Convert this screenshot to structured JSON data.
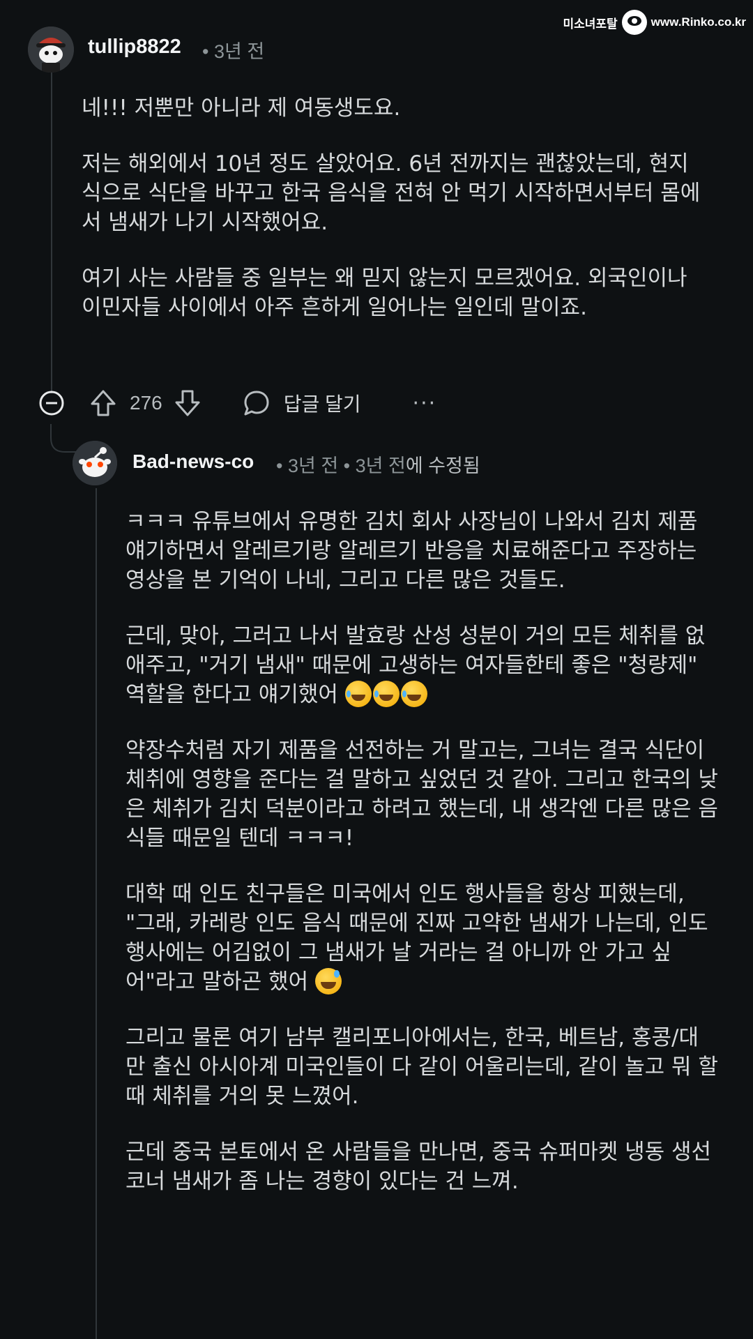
{
  "watermark": {
    "text_left": "미소녀포탈",
    "text_right": "www.Rinko.co.kr"
  },
  "comment1": {
    "username": "tullip8822",
    "time": "3년 전",
    "paragraphs": [
      "네!!! 저뿐만 아니라 제 여동생도요.",
      "저는 해외에서 10년 정도 살았어요. 6년 전까지는 괜찮았는데, 현지식으로 식단을 바꾸고 한국 음식을 전혀 안 먹기 시작하면서부터 몸에서 냄새가 나기 시작했어요.",
      "여기 사는 사람들 중 일부는 왜 믿지 않는지 모르겠어요. 외국인이나 이민자들 사이에서 아주 흔하게 일어나는 일인데 말이죠."
    ],
    "score": "276",
    "reply_label": "답글 달기",
    "more": "···"
  },
  "comment2": {
    "username": "Bad-news-co",
    "time": "3년 전",
    "edited_time": "3년 전",
    "edited_suffix": "에 수정됨",
    "paragraphs": [
      "ㅋㅋㅋ 유튜브에서 유명한 김치 회사 사장님이 나와서 김치 제품 얘기하면서 알레르기랑 알레르기 반응을 치료해준다고 주장하는 영상을 본 기억이 나네, 그리고 다른 많은 것들도.",
      "근데, 맞아, 그러고 나서 발효랑 산성 성분이 거의 모든 체취를 없애주고, \"거기 냄새\" 때문에 고생하는 여자들한테 좋은 \"청량제\" 역할을 한다고 얘기했어",
      "약장수처럼 자기 제품을 선전하는 거 말고는, 그녀는 결국 식단이 체취에 영향을 준다는 걸 말하고 싶었던 것 같아. 그리고 한국의 낮은 체취가 김치 덕분이라고 하려고 했는데, 내 생각엔 다른 많은 음식들 때문일 텐데 ㅋㅋㅋ!",
      "대학 때 인도 친구들은 미국에서 인도 행사들을 항상 피했는데, \"그래, 카레랑 인도 음식 때문에 진짜 고약한 냄새가 나는데, 인도 행사에는 어김없이 그 냄새가 날 거라는 걸 아니까 안 가고 싶어\"라고 말하곤 했어",
      "그리고 물론 여기 남부 캘리포니아에서는, 한국, 베트남, 홍콩/대만 출신 아시아계 미국인들이 다 같이 어울리는데, 같이 놀고 뭐 할 때 체취를 거의 못 느꼈어.",
      "근데 중국 본토에서 온 사람들을 만나면, 중국 슈퍼마켓 냉동 생선 코너 냄새가 좀 나는 경향이 있다는 건 느껴."
    ],
    "emojis": {
      "p2": [
        "rofl-emoji",
        "rofl-emoji",
        "rofl-emoji"
      ],
      "p4": [
        "sweat-smile-emoji"
      ]
    }
  }
}
